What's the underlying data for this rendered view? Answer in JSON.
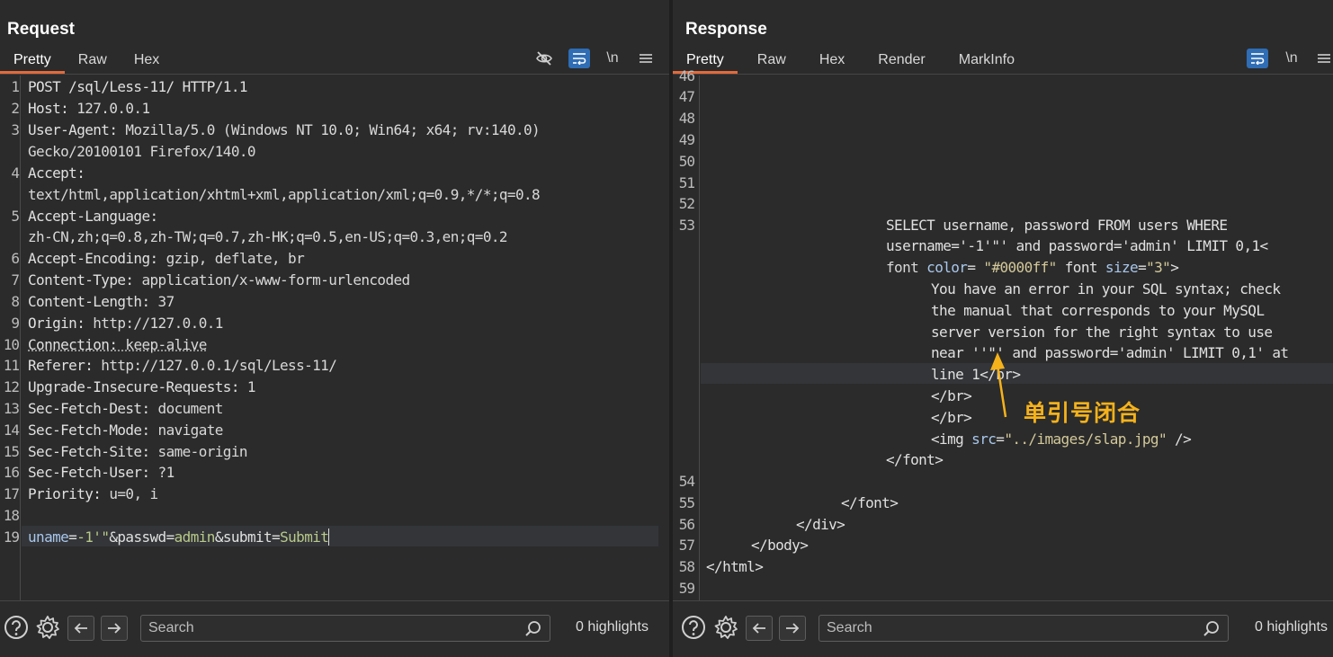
{
  "request": {
    "title": "Request",
    "tabs": [
      "Pretty",
      "Raw",
      "Hex"
    ],
    "active_tab": "Pretty",
    "toolbar": {
      "newline_label": "\\n"
    },
    "line_numbers": [
      "1",
      "2",
      "3",
      "4",
      "5",
      "6",
      "7",
      "8",
      "9",
      "10",
      "11",
      "12",
      "13",
      "14",
      "15",
      "16",
      "17",
      "18",
      "19"
    ],
    "lines": [
      {
        "k": "POST /sql/Less-11/ HTTP/1.1",
        "v": ""
      },
      {
        "k": "Host: ",
        "v": "127.0.0.1"
      },
      {
        "k": "User-Agent: ",
        "v": "Mozilla/5.0 (Windows NT 10.0; Win64; x64; rv:140.0)"
      },
      {
        "k": "",
        "v": "Gecko/20100101 Firefox/140.0"
      },
      {
        "k": "Accept:",
        "v": ""
      },
      {
        "k": "",
        "v": "text/html,application/xhtml+xml,application/xml;q=0.9,*/*;q=0.8"
      },
      {
        "k": "Accept-Language:",
        "v": ""
      },
      {
        "k": "",
        "v": "zh-CN,zh;q=0.8,zh-TW;q=0.7,zh-HK;q=0.5,en-US;q=0.3,en;q=0.2"
      },
      {
        "k": "Accept-Encoding: ",
        "v": "gzip, deflate, br"
      },
      {
        "k": "Content-Type: ",
        "v": "application/x-www-form-urlencoded"
      },
      {
        "k": "Content-Length: ",
        "v": "37"
      },
      {
        "k": "Origin: ",
        "v": "http://127.0.0.1"
      },
      {
        "k": "Connection: ",
        "v": "keep-alive"
      },
      {
        "k": "Referer: ",
        "v": "http://127.0.0.1/sql/Less-11/"
      },
      {
        "k": "Upgrade-Insecure-Requests: ",
        "v": "1"
      },
      {
        "k": "Sec-Fetch-Dest: ",
        "v": "document"
      },
      {
        "k": "Sec-Fetch-Mode: ",
        "v": "navigate"
      },
      {
        "k": "Sec-Fetch-Site: ",
        "v": "same-origin"
      },
      {
        "k": "Sec-Fetch-User: ",
        "v": "?1"
      },
      {
        "k": "Priority: ",
        "v": "u=0, i"
      },
      {
        "k": "",
        "v": ""
      }
    ],
    "body_line": {
      "p1": "uname",
      "eq1": "=",
      "v1": "-1'\"",
      "amp1": "&passwd",
      "eq2": "=",
      "v2": "admin",
      "amp2": "&submit",
      "eq3": "=",
      "v3": "Submit"
    },
    "search_placeholder": "Search",
    "highlights": "0 highlights"
  },
  "response": {
    "title": "Response",
    "tabs": [
      "Pretty",
      "Raw",
      "Hex",
      "Render",
      "MarkInfo"
    ],
    "active_tab": "Pretty",
    "toolbar": {
      "newline_label": "\\n"
    },
    "line_numbers": [
      "46",
      "47",
      "48",
      "49",
      "50",
      "51",
      "52",
      "53",
      "54",
      "55",
      "56",
      "57",
      "58",
      "59"
    ],
    "lines": {
      "sql1": "SELECT username, password FROM users WHERE",
      "sql2a": "username='-1'\"' and password='admin' LIMIT 0,1<",
      "sql3a": "font ",
      "sql3b": "color",
      "sql3c": "= ",
      "sql3d": "\"#0000ff\"",
      "sql3e": " font ",
      "sql3f": "size",
      "sql3g": "=",
      "sql3h": "\"3\"",
      "sql3i": ">",
      "err1": "You have an error in your SQL syntax; check",
      "err2": "the manual that corresponds to your MySQL",
      "err3": "server version for the right syntax to use",
      "err4": "near ''\"' and password='admin' LIMIT 0,1' at",
      "err5": "line 1</br>",
      "br1": "</br>",
      "br2": "</br>",
      "img_a": "<img ",
      "img_b": "src",
      "img_c": "=",
      "img_d": "\"../images/slap.jpg\"",
      "img_e": " />",
      "fontclose1": "</font>",
      "fontclose2": "</font>",
      "divclose": "</div>",
      "bodyclose": "</body>",
      "htmlclose": "</html>"
    },
    "annotation": "单引号闭合",
    "search_placeholder": "Search",
    "highlights": "0 highlights"
  },
  "colors": {
    "background": "#2b2b2b",
    "accent_tab": "#e36a3b",
    "toggle_on": "#2f6db4",
    "annotation": "#f5b21b"
  },
  "icons": [
    "eye-slash-icon",
    "wrap-icon",
    "newline-icon",
    "menu-icon",
    "help-icon",
    "gear-icon",
    "arrow-left-icon",
    "arrow-right-icon",
    "search-icon",
    "layout-split-icon",
    "layout-rows-icon",
    "layout-single-icon"
  ]
}
